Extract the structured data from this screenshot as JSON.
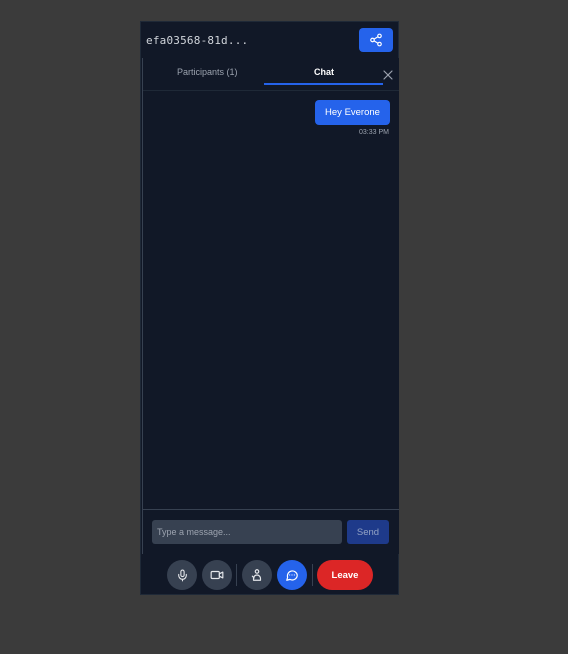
{
  "header": {
    "meeting_id": "efa03568-81d...",
    "share_icon": "share-icon"
  },
  "tabs": [
    {
      "label": "Participants (1)",
      "active": false
    },
    {
      "label": "Chat",
      "active": true
    }
  ],
  "chat": {
    "messages": [
      {
        "text": "Hey Everone",
        "time": "03:33 PM",
        "own": true
      }
    ],
    "input_placeholder": "Type a message...",
    "input_value": "",
    "send_label": "Send"
  },
  "controls": {
    "mic_icon": "microphone-icon",
    "camera_icon": "video-camera-icon",
    "raise_hand_icon": "raise-hand-icon",
    "chat_icon": "chat-bubble-icon",
    "leave_label": "Leave"
  },
  "colors": {
    "background": "#3b3b3b",
    "panel": "#111827",
    "accent": "#2563eb",
    "danger": "#dc2626"
  }
}
